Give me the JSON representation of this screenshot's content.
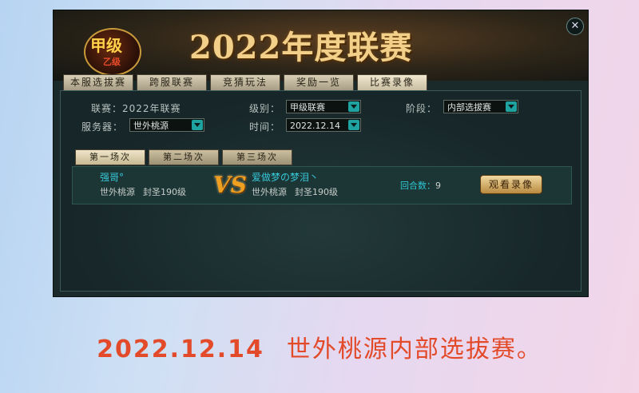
{
  "banner": {
    "title": "2022年度联赛",
    "logo_top": "甲级",
    "logo_bottom": "乙级"
  },
  "tabs": [
    {
      "label": "本服选拔赛"
    },
    {
      "label": "跨服联赛"
    },
    {
      "label": "竞猜玩法"
    },
    {
      "label": "奖励一览"
    },
    {
      "label": "比赛录像",
      "active": true
    }
  ],
  "filters": {
    "league_label": "联赛：2022年联赛",
    "level_label": "级别：",
    "level_value": "甲级联赛",
    "stage_label": "阶段：",
    "stage_value": "内部选拔赛",
    "server_label": "服务器：",
    "server_value": "世外桃源",
    "time_label": "时间：",
    "time_value": "2022.12.14"
  },
  "subtabs": [
    {
      "label": "第一场次",
      "active": true
    },
    {
      "label": "第二场次"
    },
    {
      "label": "第三场次"
    }
  ],
  "match": {
    "player1": {
      "name": "强哥°",
      "server": "世外桃源",
      "title": "封圣190级"
    },
    "vs": "VS",
    "player2": {
      "name": "爱做梦の梦泪丶",
      "server": "世外桃源",
      "title": "封圣190级"
    },
    "rounds_label": "回合数：",
    "rounds_value": "9",
    "watch_label": "观看录像"
  },
  "caption": {
    "date": "2022.12.14",
    "text": "世外桃源内部选拔赛。"
  },
  "colors": {
    "accent_cyan": "#37c8d8",
    "caption_red": "#e34a2a",
    "title_gold": "#f2d08a"
  }
}
